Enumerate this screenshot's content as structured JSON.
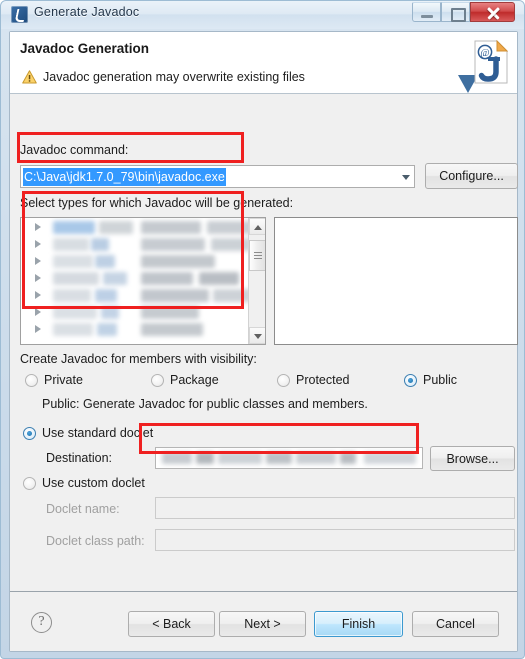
{
  "window": {
    "title": "Generate Javadoc",
    "icon": "eclipse-javadoc-icon",
    "controls": {
      "minimize": "Minimize",
      "maximize": "Maximize",
      "close": "Close"
    }
  },
  "header": {
    "title": "Javadoc Generation",
    "warning_icon": "warning-triangle-icon",
    "message": "Javadoc generation may overwrite existing files",
    "side_icon": "javadoc-document-icon"
  },
  "command": {
    "label": "Javadoc command:",
    "value": "C:\\Java\\jdk1.7.0_79\\bin\\javadoc.exe",
    "selected": true,
    "dropdown_icon": "chevron-down-icon",
    "configure_label": "Configure..."
  },
  "types": {
    "label": "Select types for which Javadoc will be generated:",
    "tree_rows": [
      {
        "expander": "triangle-right-icon",
        "content": "blurred"
      },
      {
        "expander": "triangle-right-icon",
        "content": "blurred"
      },
      {
        "expander": "triangle-right-icon",
        "content": "blurred"
      },
      {
        "expander": "triangle-right-icon",
        "content": "blurred"
      },
      {
        "expander": "triangle-right-icon",
        "content": "blurred"
      },
      {
        "expander": "triangle-right-icon",
        "content": "blurred"
      },
      {
        "expander": "triangle-right-icon",
        "content": "blurred"
      }
    ],
    "scrollbar": {
      "up_icon": "scroll-up-arrow-icon",
      "down_icon": "scroll-down-arrow-icon",
      "thumb": "scrollbar-thumb"
    },
    "members_panel": ""
  },
  "visibility": {
    "label": "Create Javadoc for members with visibility:",
    "options": [
      {
        "label": "Private",
        "selected": false
      },
      {
        "label": "Package",
        "selected": false
      },
      {
        "label": "Protected",
        "selected": false
      },
      {
        "label": "Public",
        "selected": true
      }
    ],
    "help_text": "Public: Generate Javadoc for public classes and members."
  },
  "doclet": {
    "standard_label": "Use standard doclet",
    "standard_selected": true,
    "destination_label": "Destination:",
    "destination_value": "",
    "browse_label": "Browse...",
    "custom_label": "Use custom doclet",
    "custom_selected": false,
    "doclet_name_label": "Doclet name:",
    "doclet_name_value": "",
    "doclet_class_path_label": "Doclet class path:",
    "doclet_class_path_value": ""
  },
  "buttons": {
    "help_icon": "help-question-icon",
    "back": "< Back",
    "next": "Next >",
    "finish": "Finish",
    "cancel": "Cancel"
  },
  "colors": {
    "accent": "#3399ff",
    "annotation": "#ef2020",
    "default_button": "#bee6fd",
    "close_button": "#bf2b2b",
    "warning": "#f5a623"
  }
}
